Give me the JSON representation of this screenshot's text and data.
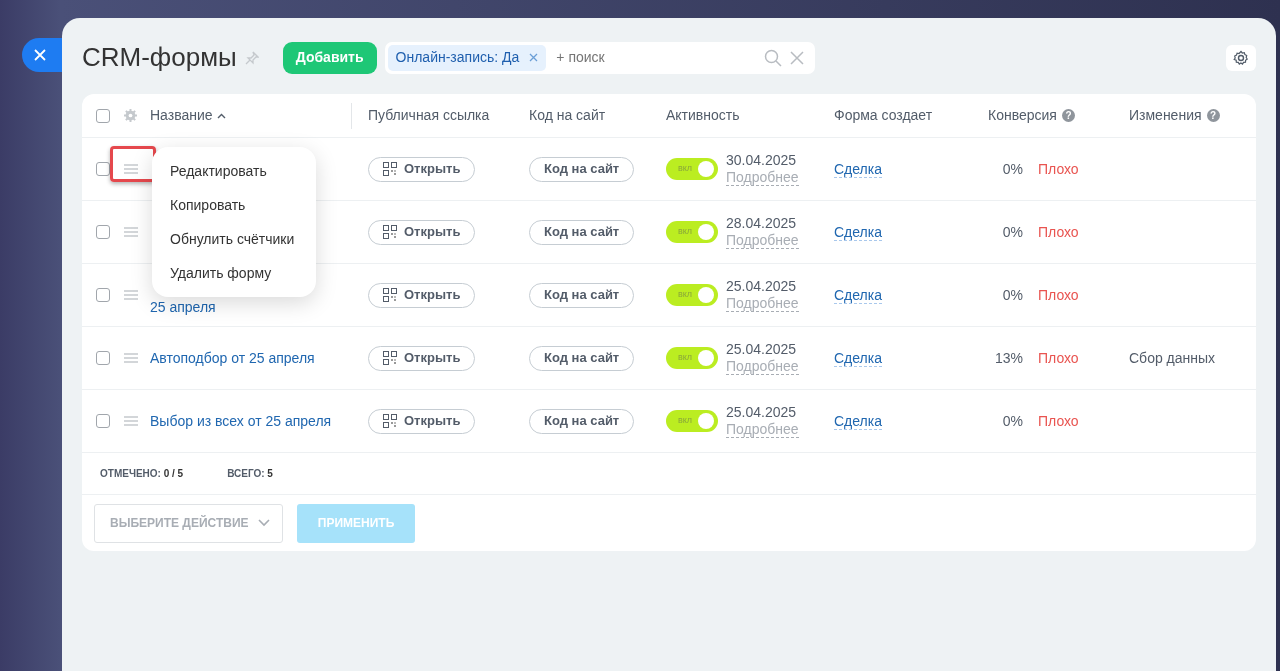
{
  "title": "CRM-формы",
  "add_button": "Добавить",
  "filter": {
    "chips": [
      {
        "label": "Онлайн-запись: Да"
      }
    ],
    "placeholder": "+ поиск"
  },
  "columns": [
    {
      "label": "Название",
      "sorted": true
    },
    {
      "label": "Публичная ссылка",
      "sorted": false
    },
    {
      "label": "Код на сайт",
      "sorted": false
    },
    {
      "label": "Активность",
      "sorted": false
    },
    {
      "label": "Форма создает",
      "sorted": false
    },
    {
      "label": "Конверсия",
      "sorted": false,
      "help": "?"
    },
    {
      "label": "Изменения",
      "sorted": false,
      "help": "?"
    }
  ],
  "header_checked": false,
  "rows": [
    {
      "checked": false,
      "highlighted": true,
      "open_button": "Открыть",
      "code_button": "Код на сайт",
      "active": true,
      "toggle_label": "вкл",
      "date": "30.04.2025",
      "details": "Подробнее",
      "creates": "Сделка",
      "conversion": "0%",
      "rating": "Плохо"
    },
    {
      "checked": false,
      "highlighted": false,
      "open_button": "Открыть",
      "code_button": "Код на сайт",
      "active": true,
      "toggle_label": "вкл",
      "date": "28.04.2025",
      "details": "Подробнее",
      "creates": "Сделка",
      "conversion": "0%",
      "rating": "Плохо"
    },
    {
      "checked": false,
      "highlighted": false,
      "name_tail": "25 апреля",
      "open_button": "Открыть",
      "code_button": "Код на сайт",
      "active": true,
      "toggle_label": "вкл",
      "date": "25.04.2025",
      "details": "Подробнее",
      "creates": "Сделка",
      "conversion": "0%",
      "rating": "Плохо"
    },
    {
      "checked": false,
      "highlighted": false,
      "name": "Автоподбор от 25 апреля",
      "open_button": "Открыть",
      "code_button": "Код на сайт",
      "active": true,
      "toggle_label": "вкл",
      "date": "25.04.2025",
      "details": "Подробнее",
      "creates": "Сделка",
      "conversion": "13%",
      "rating": "Плохо",
      "changes": "Сбор данных"
    },
    {
      "checked": false,
      "highlighted": false,
      "name": "Выбор из всех от 25 апреля",
      "open_button": "Открыть",
      "code_button": "Код на сайт",
      "active": true,
      "toggle_label": "вкл",
      "date": "25.04.2025",
      "details": "Подробнее",
      "creates": "Сделка",
      "conversion": "0%",
      "rating": "Плохо"
    }
  ],
  "context_menu": {
    "items": [
      "Редактировать",
      "Копировать",
      "Обнулить счётчики",
      "Удалить форму"
    ]
  },
  "summary": {
    "checked_label": "ОТМЕЧЕНО:",
    "checked_value": "0 / 5",
    "total_label": "ВСЕГО:",
    "total_value": "5"
  },
  "action_select": {
    "placeholder": "ВЫБЕРИТЕ ДЕЙСТВИЕ"
  },
  "apply_button": {
    "label": "ПРИМЕНИТЬ",
    "disabled": true
  }
}
